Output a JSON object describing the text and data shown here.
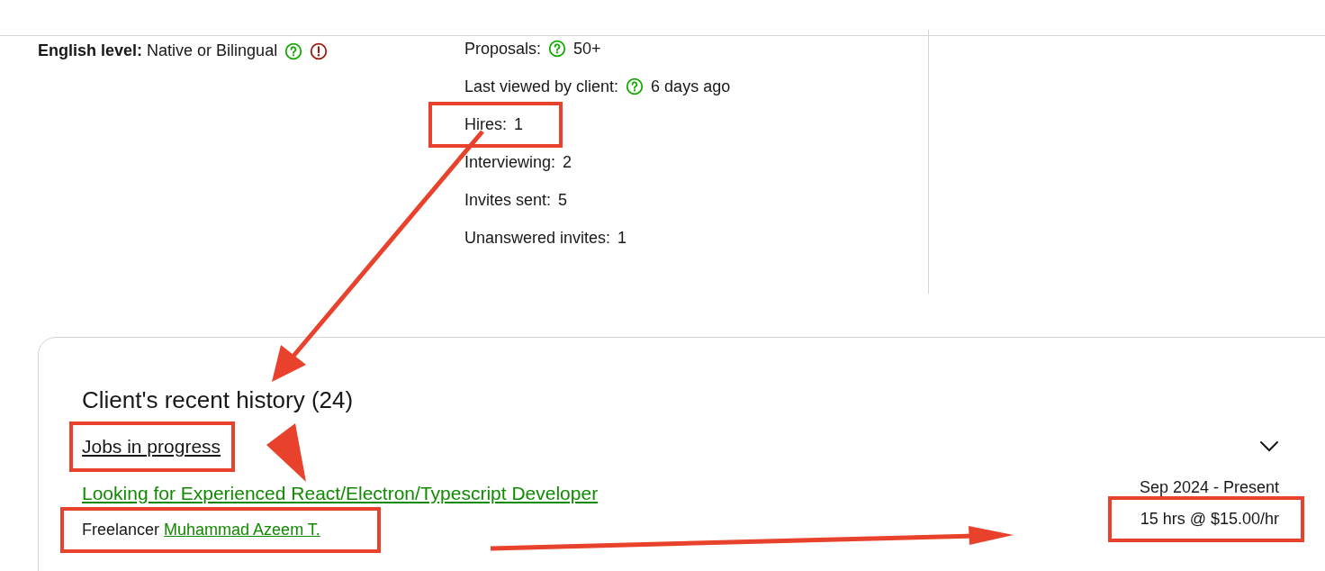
{
  "job_details": {
    "english_level": {
      "label": "English level:",
      "value": "Native or Bilingual",
      "help": true,
      "warning": true
    }
  },
  "activity": [
    {
      "label": "Proposals:",
      "value": "50+",
      "help": true,
      "highlighted": false
    },
    {
      "label": "Last viewed by client:",
      "value": "6 days ago",
      "help": true,
      "highlighted": false
    },
    {
      "label": "Hires:",
      "value": "1",
      "help": false,
      "highlighted": true
    },
    {
      "label": "Interviewing:",
      "value": "2",
      "help": false,
      "highlighted": false
    },
    {
      "label": "Invites sent:",
      "value": "5",
      "help": false,
      "highlighted": false
    },
    {
      "label": "Unanswered invites:",
      "value": "1",
      "help": false,
      "highlighted": false
    }
  ],
  "history": {
    "title": "Client's recent history (24)",
    "section": {
      "label": "Jobs in progress",
      "expanded": false,
      "highlighted": true
    },
    "jobs": [
      {
        "title": "Looking for Experienced React/Electron/Typescript Developer",
        "freelancer_label": "Freelancer",
        "freelancer": "Muhammad Azeem T.",
        "freelancer_highlighted": true,
        "dates": "Sep 2024 - Present",
        "rate": "15 hrs @ $15.00/hr",
        "rate_highlighted": true
      }
    ]
  }
}
